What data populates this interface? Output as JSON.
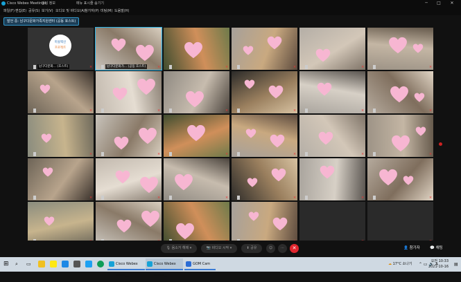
{
  "window": {
    "title": "Cisco Webex Meetings",
    "meeting_info": "미팅 정보",
    "menu_toggle": "메뉴 표시줄 숨기기",
    "controls": {
      "minimize": "─",
      "maximize": "□",
      "close": "✕"
    }
  },
  "menu": [
    "파일(F)",
    "편집(E)",
    "공유(S)",
    "보기(V)",
    "오디오 및 비디오(A)",
    "참가자(P)",
    "미팅(M)",
    "도움말(H)"
  ],
  "presenter_pill": "발언 중: 남구다문화가족지원센터 (공동 호스트)",
  "tiles": [
    {
      "label": "남구다문화... (호스트)",
      "kind": "logo",
      "logo_line1": "마을백신",
      "logo_line2": "프로젝트"
    },
    {
      "label": "남구다문화가... (공동 호스트)",
      "kind": "video",
      "highlight": true
    },
    {
      "label": "",
      "kind": "video"
    },
    {
      "label": "",
      "kind": "video"
    },
    {
      "label": "",
      "kind": "video"
    },
    {
      "label": "",
      "kind": "video"
    },
    {
      "label": "",
      "kind": "video"
    },
    {
      "label": "",
      "kind": "video"
    },
    {
      "label": "",
      "kind": "video"
    },
    {
      "label": "",
      "kind": "video"
    },
    {
      "label": "",
      "kind": "video"
    },
    {
      "label": "",
      "kind": "video"
    },
    {
      "label": "",
      "kind": "video"
    },
    {
      "label": "",
      "kind": "video"
    },
    {
      "label": "",
      "kind": "video"
    },
    {
      "label": "",
      "kind": "video"
    },
    {
      "label": "",
      "kind": "video"
    },
    {
      "label": "",
      "kind": "video"
    },
    {
      "label": "",
      "kind": "video"
    },
    {
      "label": "",
      "kind": "video"
    },
    {
      "label": "",
      "kind": "video"
    },
    {
      "label": "",
      "kind": "video"
    },
    {
      "label": "",
      "kind": "video"
    },
    {
      "label": "",
      "kind": "video"
    },
    {
      "label": "",
      "kind": "video"
    },
    {
      "label": "",
      "kind": "video"
    },
    {
      "label": "",
      "kind": "video"
    },
    {
      "label": "",
      "kind": "video"
    },
    {
      "label": "",
      "kind": "empty"
    },
    {
      "label": "",
      "kind": "empty"
    }
  ],
  "controls": {
    "mute": "음소거 해제",
    "video": "비디오 시작",
    "share": "공유",
    "participants": "참가자",
    "chat": "채팅"
  },
  "taskbar": {
    "windows": [
      "Cisco Webex Meeti...",
      "Cisco Webex Meeti...",
      "GOM Cam"
    ],
    "weather": "17°C 소나기",
    "time": "오전 10:33",
    "date": "2021-10-16"
  },
  "colors": {
    "accent": "#2ab3e8",
    "end_call": "#e0262e",
    "heart": "#f7b6d2"
  }
}
